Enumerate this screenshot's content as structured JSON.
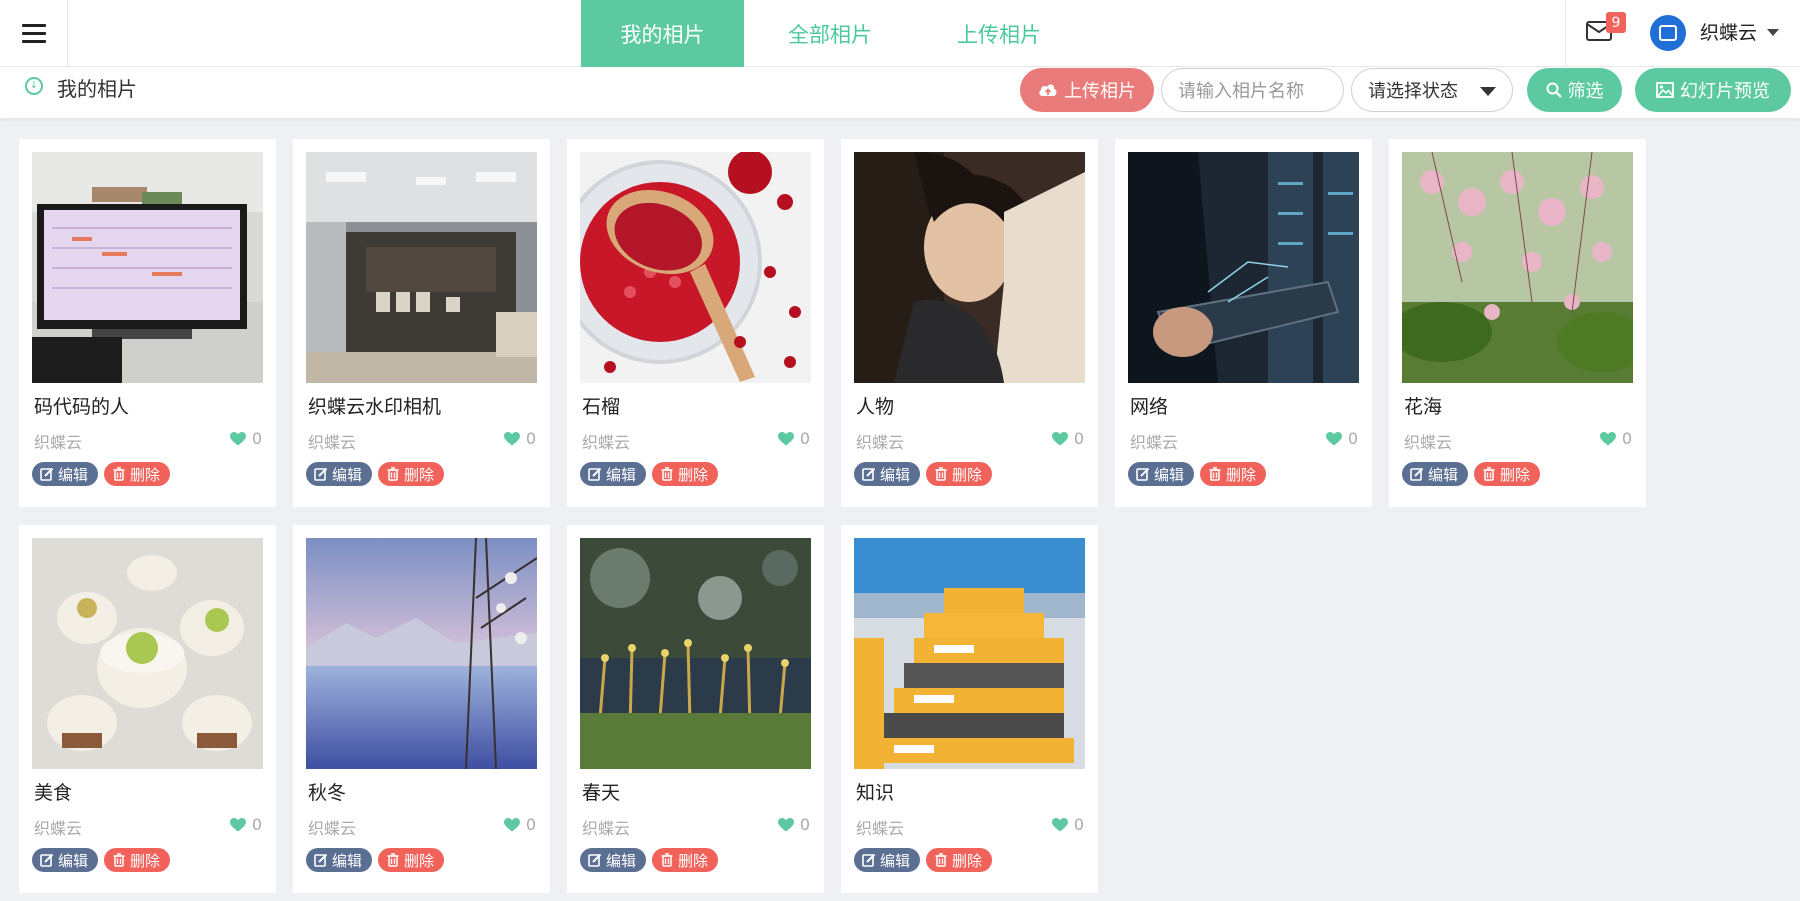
{
  "topbar": {
    "tabs": [
      {
        "label": "我的相片",
        "active": true
      },
      {
        "label": "全部相片",
        "active": false
      },
      {
        "label": "上传相片",
        "active": false
      }
    ],
    "notifications_count": "9",
    "user_name": "织蝶云"
  },
  "subbar": {
    "title": "我的相片",
    "upload_label": "上传相片",
    "search_placeholder": "请输入相片名称",
    "status_select": "请选择状态",
    "filter_label": "筛选",
    "slideshow_label": "幻灯片预览"
  },
  "colors": {
    "accent": "#5cc9a0",
    "danger": "#f0625a",
    "upload": "#e97c7a",
    "edit": "#5b6f93"
  },
  "photos": [
    {
      "title": "码代码的人",
      "author": "织蝶云",
      "likes": "0",
      "edit": "编辑",
      "delete": "删除",
      "thumb": "monitor"
    },
    {
      "title": "织蝶云水印相机",
      "author": "织蝶云",
      "likes": "0",
      "edit": "编辑",
      "delete": "删除",
      "thumb": "office"
    },
    {
      "title": "石榴",
      "author": "织蝶云",
      "likes": "0",
      "edit": "编辑",
      "delete": "删除",
      "thumb": "pomegranate"
    },
    {
      "title": "人物",
      "author": "织蝶云",
      "likes": "0",
      "edit": "编辑",
      "delete": "删除",
      "thumb": "person"
    },
    {
      "title": "网络",
      "author": "织蝶云",
      "likes": "0",
      "edit": "编辑",
      "delete": "删除",
      "thumb": "network"
    },
    {
      "title": "花海",
      "author": "织蝶云",
      "likes": "0",
      "edit": "编辑",
      "delete": "删除",
      "thumb": "blossom"
    },
    {
      "title": "美食",
      "author": "织蝶云",
      "likes": "0",
      "edit": "编辑",
      "delete": "删除",
      "thumb": "food"
    },
    {
      "title": "秋冬",
      "author": "织蝶云",
      "likes": "0",
      "edit": "编辑",
      "delete": "删除",
      "thumb": "lake"
    },
    {
      "title": "春天",
      "author": "织蝶云",
      "likes": "0",
      "edit": "编辑",
      "delete": "删除",
      "thumb": "moss"
    },
    {
      "title": "知识",
      "author": "织蝶云",
      "likes": "0",
      "edit": "编辑",
      "delete": "删除",
      "thumb": "binders"
    }
  ]
}
